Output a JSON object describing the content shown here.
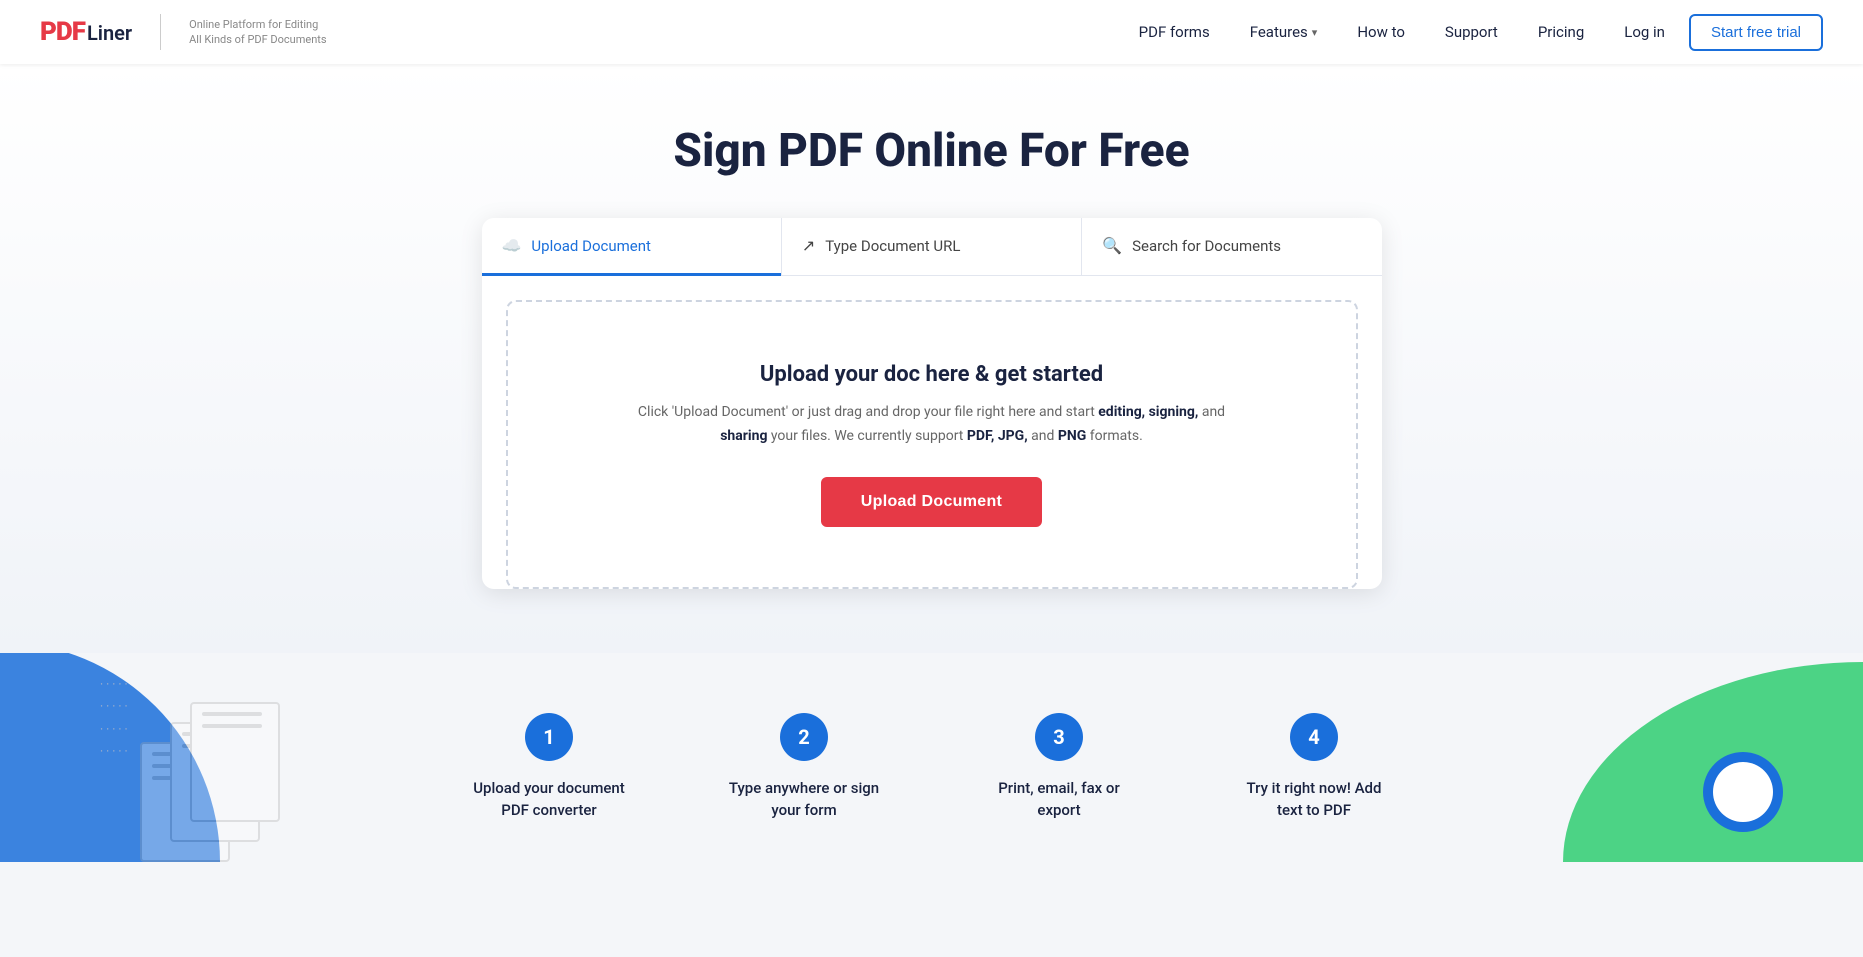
{
  "logo": {
    "pdf_text": "PDF",
    "liner_text": "Liner",
    "tagline_line1": "Online Platform for Editing",
    "tagline_line2": "All Kinds of PDF Documents"
  },
  "nav": {
    "pdf_forms": "PDF forms",
    "features": "Features",
    "chevron": "▾",
    "how_to": "How to",
    "support": "Support",
    "pricing": "Pricing",
    "login": "Log in",
    "trial_btn": "Start free trial"
  },
  "hero": {
    "headline": "Sign PDF Online For Free"
  },
  "tabs": {
    "upload_label": "Upload Document",
    "url_label": "Type Document URL",
    "search_label": "Search for Documents"
  },
  "drop_area": {
    "title": "Upload your doc here & get started",
    "desc_normal": "Click 'Upload Document' or just drag and drop your file right here and start ",
    "desc_bold1": "editing, signing,",
    "desc_normal2": " and ",
    "desc_bold2": "sharing",
    "desc_normal3": " your files. We currently support ",
    "desc_bold3": "PDF, JPG,",
    "desc_normal4": " and ",
    "desc_bold4": "PNG",
    "desc_normal5": " formats.",
    "upload_btn": "Upload Document"
  },
  "steps": [
    {
      "num": "1",
      "label": "Upload your document\nPDF converter"
    },
    {
      "num": "2",
      "label": "Type anywhere or sign\nyour form"
    },
    {
      "num": "3",
      "label": "Print, email, fax or\nexport"
    },
    {
      "num": "4",
      "label": "Try it right now! Add\ntext to PDF"
    }
  ]
}
